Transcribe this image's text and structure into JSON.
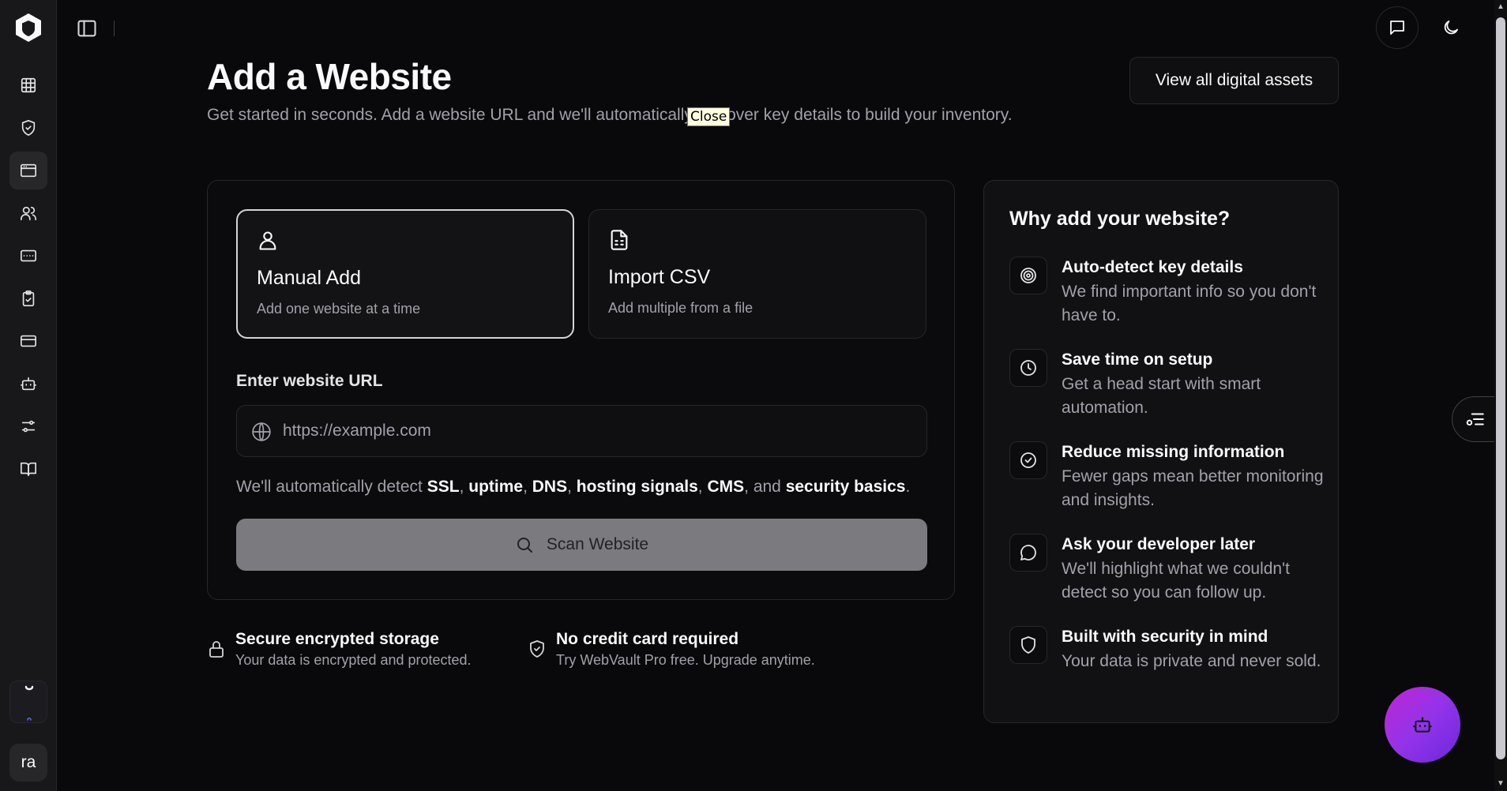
{
  "app": {
    "avatar_initials": "ra",
    "accent_color": "#a855f7"
  },
  "sidebar": {
    "items": [
      {
        "icon": "grid-icon",
        "active": false
      },
      {
        "icon": "shield-check-icon",
        "active": false
      },
      {
        "icon": "browser-window-icon",
        "active": true
      },
      {
        "icon": "users-icon",
        "active": false
      },
      {
        "icon": "id-card-icon",
        "active": false
      },
      {
        "icon": "clipboard-check-icon",
        "active": false
      },
      {
        "icon": "credit-card-icon",
        "active": false
      },
      {
        "icon": "bot-icon",
        "active": false
      },
      {
        "icon": "sliders-icon",
        "active": false
      },
      {
        "icon": "book-open-icon",
        "active": false
      }
    ]
  },
  "header": {
    "title": "Add a Website",
    "subtitle": "Get started in seconds. Add a website URL and we'll automatically discover key details to build your inventory.",
    "tooltip": "Close",
    "view_all_label": "View all digital assets"
  },
  "add_options": [
    {
      "title": "Manual Add",
      "description": "Add one website at a time",
      "icon": "user-icon",
      "selected": true
    },
    {
      "title": "Import CSV",
      "description": "Add multiple from a file",
      "icon": "file-spreadsheet-icon",
      "selected": false
    }
  ],
  "url_form": {
    "label": "Enter website URL",
    "placeholder": "https://example.com",
    "value": "",
    "detect_prefix": "We'll automatically detect ",
    "detect_items": [
      "SSL",
      "uptime",
      "DNS",
      "hosting signals",
      "CMS"
    ],
    "detect_last": "security basics",
    "detect_and": "and",
    "scan_label": "Scan Website"
  },
  "trust": [
    {
      "title": "Secure encrypted storage",
      "description": "Your data is encrypted and protected.",
      "icon": "lock-icon"
    },
    {
      "title": "No credit card required",
      "description": "Try WebVault Pro free. Upgrade anytime.",
      "icon": "shield-check-icon"
    }
  ],
  "why": {
    "title": "Why add your website?",
    "benefits": [
      {
        "title": "Auto-detect key details",
        "description": "We find important info so you don't have to.",
        "icon": "target-icon"
      },
      {
        "title": "Save time on setup",
        "description": "Get a head start with smart automation.",
        "icon": "clock-icon"
      },
      {
        "title": "Reduce missing information",
        "description": "Fewer gaps mean better monitoring and insights.",
        "icon": "check-circle-icon"
      },
      {
        "title": "Ask your developer later",
        "description": "We'll highlight what we couldn't detect so you can follow up.",
        "icon": "message-circle-icon"
      },
      {
        "title": "Built with security in mind",
        "description": "Your data is private and never sold.",
        "icon": "shield-icon"
      }
    ]
  }
}
